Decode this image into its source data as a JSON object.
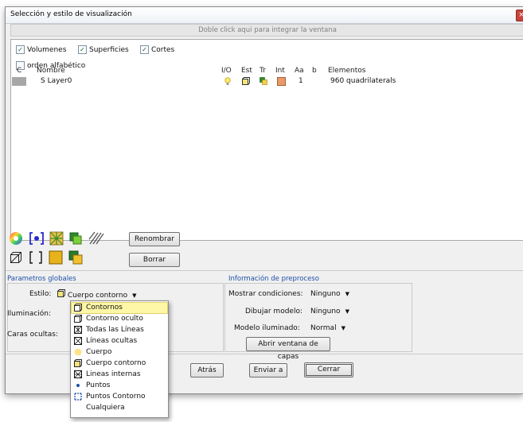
{
  "window": {
    "title": "Selección y estilo de visualización",
    "close_glyph": "×"
  },
  "dock_hint": "Doble click aqui para integrar la ventana",
  "filters": {
    "volumes": {
      "label": "Volumenes",
      "checked": true
    },
    "surfaces": {
      "label": "Superficies",
      "checked": true
    },
    "cuts": {
      "label": "Cortes",
      "checked": true
    },
    "alpha": {
      "label": "orden alfabético",
      "checked": false
    }
  },
  "table": {
    "columns": [
      "C",
      "Nombre",
      "I/O",
      "Est",
      "Tr",
      "Int",
      "Aa",
      "b",
      "Elementos"
    ],
    "rows": [
      {
        "name": "S Layer0",
        "aa": "1",
        "elements": "960 quadrilaterals"
      }
    ]
  },
  "tools": {
    "rename": "Renombrar",
    "delete": "Borrar"
  },
  "global_params": {
    "title": "Parametros globales",
    "style_label": "Estilo:",
    "style_value": "Cuerpo contorno",
    "lighting_label": "Iluminación:",
    "hidden_label": "Caras ocultas:"
  },
  "preprocess": {
    "title": "Información de preproceso",
    "show_conditions_label": "Mostrar condiciones:",
    "show_conditions_value": "Ninguno",
    "draw_model_label": "Dibujar modelo:",
    "draw_model_value": "Ninguno",
    "lit_model_label": "Modelo iluminado:",
    "lit_model_value": "Normal",
    "layers_button": "Abrir ventana de capas"
  },
  "footer": {
    "back": "Atrás",
    "send": "Enviar a",
    "close": "Cerrar"
  },
  "style_menu": [
    {
      "label": "Contornos",
      "icon": "contour-icon",
      "highlighted": true
    },
    {
      "label": "Contorno oculto",
      "icon": "hidden-contour-icon"
    },
    {
      "label": "Todas las Líneas",
      "icon": "all-lines-icon"
    },
    {
      "label": "Líneas ocultas",
      "icon": "hidden-lines-icon"
    },
    {
      "label": "Cuerpo",
      "icon": "body-icon"
    },
    {
      "label": "Cuerpo contorno",
      "icon": "body-contour-icon"
    },
    {
      "label": "Lineas internas",
      "icon": "inner-lines-icon"
    },
    {
      "label": "Puntos",
      "icon": "points-icon"
    },
    {
      "label": "Puntos Contorno",
      "icon": "points-contour-icon"
    },
    {
      "label": "Cualquiera",
      "icon": ""
    }
  ],
  "colors": {
    "accent_blue": "#1f4fa8",
    "highlight": "#fff7a8",
    "layer_color": "#a7a7a7"
  }
}
